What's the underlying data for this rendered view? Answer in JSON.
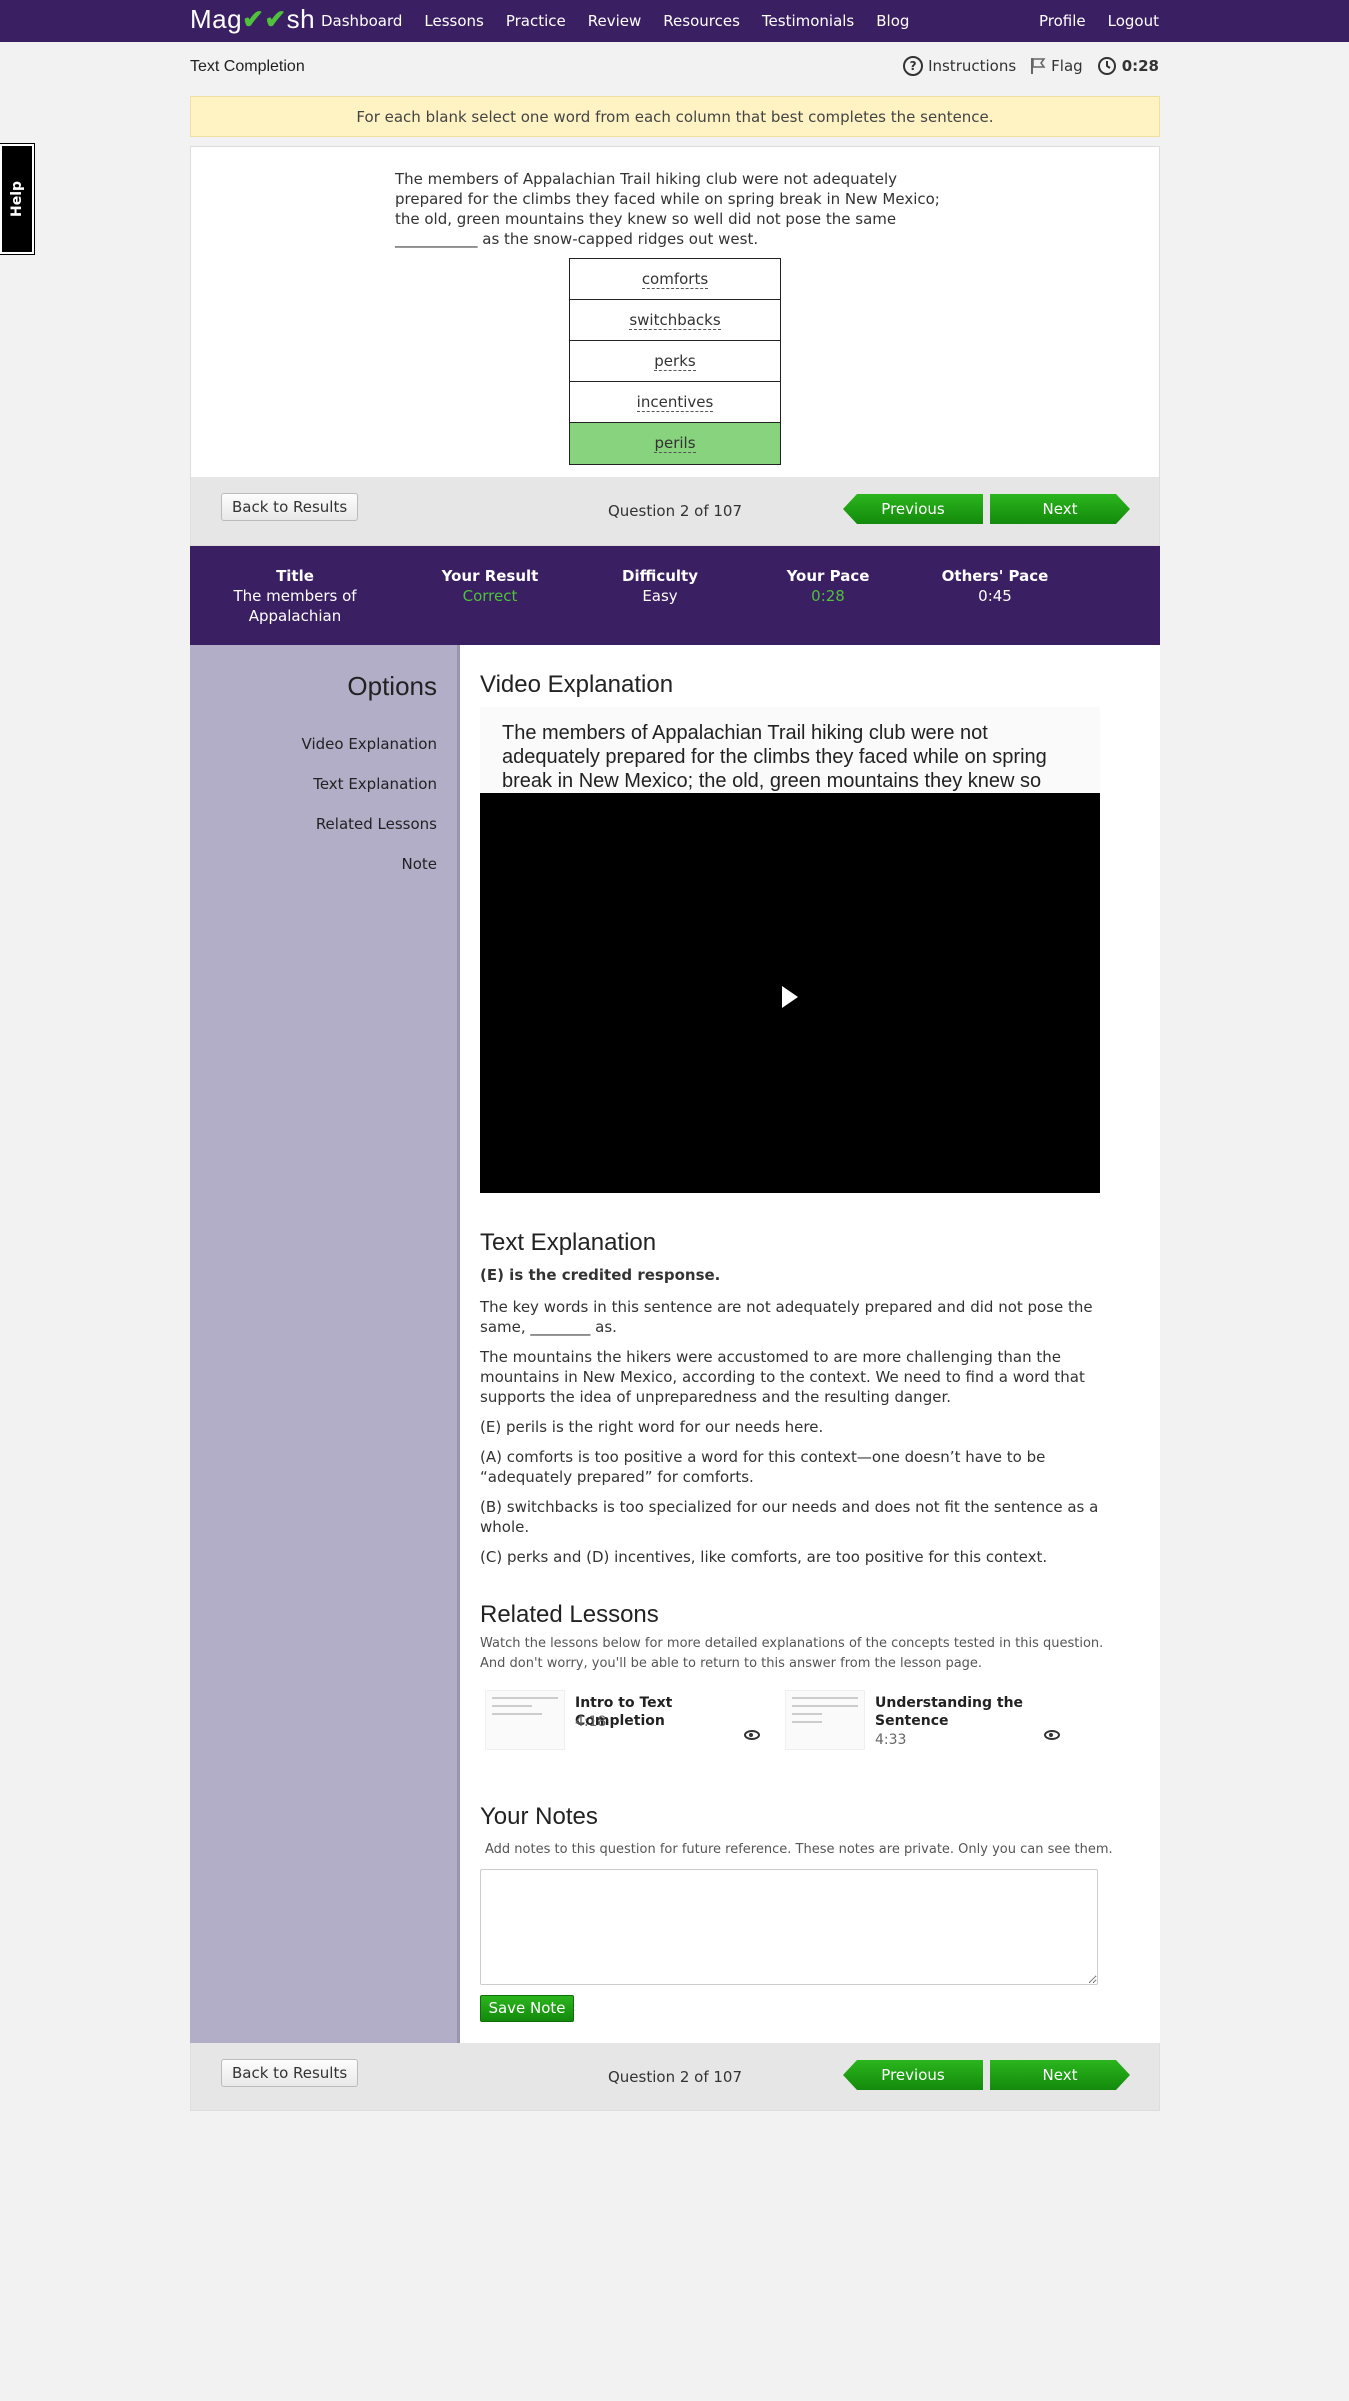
{
  "nav": {
    "logo": "Magoosh",
    "items": [
      "Dashboard",
      "Lessons",
      "Practice",
      "Review",
      "Resources",
      "Testimonials",
      "Blog"
    ],
    "right": [
      "Profile",
      "Logout"
    ]
  },
  "help": "Help",
  "header": {
    "title": "Text Completion",
    "instructions": "Instructions",
    "flag": "Flag",
    "timer": "0:28"
  },
  "instruction_text": "For each blank select one word from each column that best completes the sentence.",
  "question": {
    "stem": "The members of Appalachian Trail hiking club were not adequately prepared for the climbs they faced while on spring break in New Mexico; the old, green mountains they knew so well did not pose the same ___________ as the snow-capped ridges out west.",
    "choices": [
      "comforts",
      "switchbacks",
      "perks",
      "incentives",
      "perils"
    ],
    "selected_index": 4
  },
  "navbar": {
    "back": "Back to Results",
    "count": "Question 2 of 107",
    "previous": "Previous",
    "next": "Next"
  },
  "stats": {
    "title_label": "Title",
    "title_value": "The members of Appalachian",
    "result_label": "Your Result",
    "result_value": "Correct",
    "difficulty_label": "Difficulty",
    "difficulty_value": "Easy",
    "pace_label": "Your Pace",
    "pace_value": "0:28",
    "others_label": "Others' Pace",
    "others_value": "0:45"
  },
  "options": {
    "heading": "Options",
    "items": [
      "Video Explanation",
      "Text Explanation",
      "Related Lessons",
      "Note"
    ]
  },
  "video": {
    "heading": "Video Explanation",
    "preview_text": "The members of Appalachian Trail hiking club were not adequately prepared for the climbs they faced while on spring break in New Mexico; the old, green mountains they knew so well did not pose"
  },
  "text_explanation": {
    "heading": "Text Explanation",
    "credited": "(E) is the credited response.",
    "paragraphs": [
      "The key words in this sentence are not adequately prepared and did not pose the same, ________ as.",
      "The mountains the hikers were accustomed to are more challenging than the mountains in New Mexico, according to the context. We need to find a word that supports the idea of unpreparedness and the resulting danger.",
      "(E) perils is the right word for our needs here.",
      "(A) comforts is too positive a word for this context—one doesn’t have to be “adequately prepared” for comforts.",
      "(B) switchbacks is too specialized for our needs and does not fit the sentence as a whole.",
      "(C) perks and (D) incentives, like comforts, are too positive for this context."
    ]
  },
  "related": {
    "heading": "Related Lessons",
    "description": "Watch the lessons below for more detailed explanations of the concepts tested in this question. And don't worry, you'll be able to return to this answer from the lesson page.",
    "lessons": [
      {
        "title": "Intro to Text Completion",
        "duration": "4:18"
      },
      {
        "title": "Understanding the Sentence",
        "duration": "4:33"
      }
    ]
  },
  "notes": {
    "heading": "Your Notes",
    "description": "Add notes to this question for future reference. These notes are private. Only you can see them.",
    "save": "Save Note"
  }
}
